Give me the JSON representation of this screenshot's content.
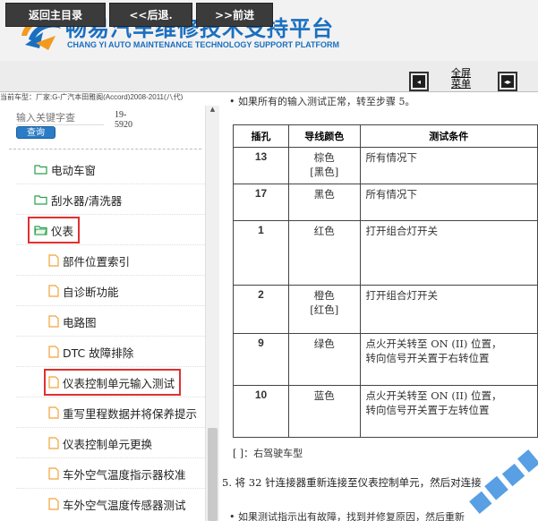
{
  "header": {
    "title_cn": "畅易汽车维修技术支持平台",
    "title_en": "CHANG YI AUTO MAINTENANCE TECHNOLOGY SUPPORT PLATFORM"
  },
  "toolbar": {
    "home_label": "返回主目录",
    "back_label": "<<后退.",
    "forward_label": ">>前进",
    "fullscreen_line1": "全屏",
    "fullscreen_line2": "菜单"
  },
  "vehicle": "当前车型：厂家:G-广汽本田雅阁(Accord)2008-2011(八代)",
  "search": {
    "placeholder": "输入关键字查",
    "button_label": "查询",
    "side_line1": "19-",
    "side_line2": "5920"
  },
  "tree": {
    "folders": [
      {
        "label": "电动车窗"
      },
      {
        "label": "刮水器/清洗器"
      },
      {
        "label": "仪表"
      }
    ],
    "docs": [
      {
        "label": "部件位置索引"
      },
      {
        "label": "自诊断功能"
      },
      {
        "label": "电路图"
      },
      {
        "label": "DTC 故障排除"
      },
      {
        "label": "仪表控制单元输入测试"
      },
      {
        "label": "重写里程数据并将保养提示"
      },
      {
        "label": "仪表控制单元更换"
      },
      {
        "label": "车外空气温度指示器校准"
      },
      {
        "label": "车外空气温度传感器测试"
      }
    ]
  },
  "content": {
    "top_line": "• 如果所有的输入测试正常，转至步骤 5。",
    "table": {
      "headers": [
        "插孔",
        "导线颜色",
        "测试条件"
      ],
      "rows": [
        {
          "pin": "13",
          "color1": "棕色",
          "color2": "[黑色]",
          "cond1": "所有情况下",
          "cond2": ""
        },
        {
          "pin": "17",
          "color1": "黑色",
          "color2": "",
          "cond1": "所有情况下",
          "cond2": ""
        },
        {
          "pin": "1",
          "color1": "红色",
          "color2": "",
          "cond1": "打开组合灯开关",
          "cond2": ""
        },
        {
          "pin": "2",
          "color1": "橙色",
          "color2": "[红色]",
          "cond1": "打开组合灯开关",
          "cond2": ""
        },
        {
          "pin": "9",
          "color1": "绿色",
          "color2": "",
          "cond1": "点火开关转至 ON (II) 位置，",
          "cond2": "转向信号开关置于右转位置"
        },
        {
          "pin": "10",
          "color1": "蓝色",
          "color2": "",
          "cond1": "点火开关转至 ON (II) 位置，",
          "cond2": "转向信号开关置于左转位置"
        }
      ]
    },
    "note": "[ ]：右驾驶车型",
    "step5": "5. 将 32 针连接器重新连接至仪表控制单元，然后对连接",
    "last_line": "• 如果测试指示出有故障，找到并修复原因，然后重新"
  },
  "colors": {
    "brand_blue": "#1a6fc0",
    "toolbar_button": "#3b3b3b",
    "highlight_red": "#e03030",
    "folder_green": "#2aa04a",
    "doc_orange": "#f2a23a"
  }
}
